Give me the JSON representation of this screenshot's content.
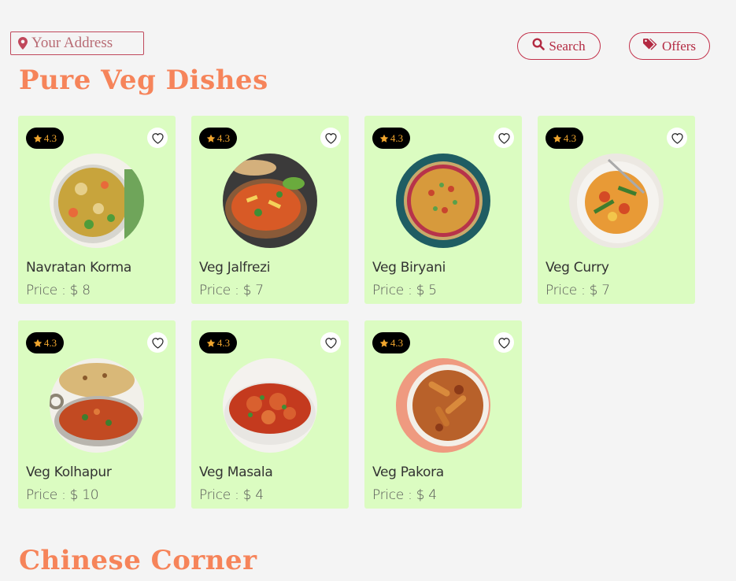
{
  "address": {
    "placeholder": "Your Address",
    "icon": "map-pin-icon"
  },
  "nav": {
    "search_label": "Search",
    "offers_label": "Offers"
  },
  "sections": {
    "veg_title": "Pure Veg Dishes",
    "chinese_title": "Chinese Corner"
  },
  "colors": {
    "accent": "#f6845a",
    "brand": "#c2304a",
    "card_bg": "#dbfcc1",
    "rating_star": "#f0a52e"
  },
  "dishes": [
    {
      "name": "Navratan Korma",
      "price": "Price : $ 8",
      "rating": "4.3"
    },
    {
      "name": "Veg Jalfrezi",
      "price": "Price : $ 7",
      "rating": "4.3"
    },
    {
      "name": "Veg Biryani",
      "price": "Price : $ 5",
      "rating": "4.3"
    },
    {
      "name": "Veg Curry",
      "price": "Price : $ 7",
      "rating": "4.3"
    },
    {
      "name": "Veg Kolhapur",
      "price": "Price : $ 10",
      "rating": "4.3"
    },
    {
      "name": "Veg Masala",
      "price": "Price : $ 4",
      "rating": "4.3"
    },
    {
      "name": "Veg Pakora",
      "price": "Price : $ 4",
      "rating": "4.3"
    }
  ]
}
